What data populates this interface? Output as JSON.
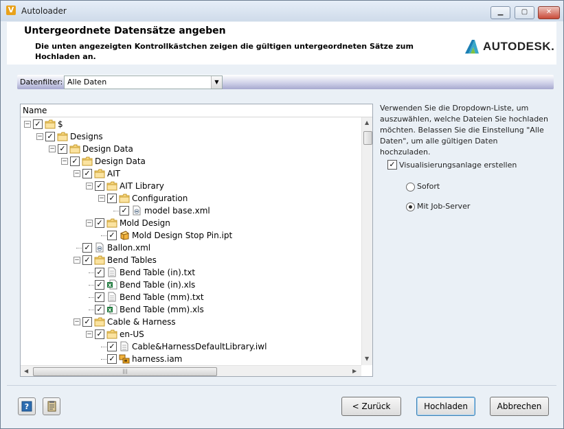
{
  "window": {
    "title": "Autoloader",
    "minimize": "▭",
    "maximize": "◻",
    "close": "✕"
  },
  "header": {
    "title": "Untergeordnete Datensätze angeben",
    "description": "Die unten angezeigten Kontrollkästchen zeigen die gültigen untergeordneten Sätze zum Hochladen an.",
    "logo_text": "AUTODESK."
  },
  "filter": {
    "label": "Datenfilter:",
    "value": "Alle Daten"
  },
  "tree": {
    "column_header": "Name",
    "rows": [
      {
        "label": "$",
        "level": 0,
        "type": "folder",
        "expander": true
      },
      {
        "label": "Designs",
        "level": 1,
        "type": "folder",
        "expander": true
      },
      {
        "label": "Design Data",
        "level": 2,
        "type": "folder",
        "expander": true
      },
      {
        "label": "Design Data",
        "level": 3,
        "type": "folder",
        "expander": true
      },
      {
        "label": "AIT",
        "level": 4,
        "type": "folder",
        "expander": true
      },
      {
        "label": "AIT Library",
        "level": 5,
        "type": "folder",
        "expander": true
      },
      {
        "label": "Configuration",
        "level": 6,
        "type": "folder",
        "expander": true
      },
      {
        "label": "model base.xml",
        "level": 7,
        "type": "xml",
        "expander": false
      },
      {
        "label": "Mold Design",
        "level": 5,
        "type": "folder",
        "expander": true
      },
      {
        "label": "Mold Design Stop Pin.ipt",
        "level": 6,
        "type": "ipt",
        "expander": false
      },
      {
        "label": "Ballon.xml",
        "level": 4,
        "type": "xml",
        "expander": false
      },
      {
        "label": "Bend Tables",
        "level": 4,
        "type": "folder",
        "expander": true
      },
      {
        "label": "Bend Table (in).txt",
        "level": 5,
        "type": "txt",
        "expander": false
      },
      {
        "label": "Bend Table (in).xls",
        "level": 5,
        "type": "xls",
        "expander": false
      },
      {
        "label": "Bend Table (mm).txt",
        "level": 5,
        "type": "txt",
        "expander": false
      },
      {
        "label": "Bend Table (mm).xls",
        "level": 5,
        "type": "xls",
        "expander": false
      },
      {
        "label": "Cable & Harness",
        "level": 4,
        "type": "folder",
        "expander": true
      },
      {
        "label": "en-US",
        "level": 5,
        "type": "folder",
        "expander": true
      },
      {
        "label": "Cable&HarnessDefaultLibrary.iwl",
        "level": 6,
        "type": "txt",
        "expander": false
      },
      {
        "label": "harness.iam",
        "level": 6,
        "type": "iam",
        "expander": false
      }
    ]
  },
  "info": {
    "text": "Verwenden Sie die Dropdown-Liste, um auszuwählen, welche Dateien Sie hochladen möchten. Belassen Sie die Einstellung \"Alle Daten\", um alle gültigen Daten hochzuladen.",
    "viz_checkbox_label": "Visualisierungsanlage erstellen",
    "viz_checked": true,
    "radio_now": "Sofort",
    "radio_job": "Mit Job-Server",
    "selected_radio": "job"
  },
  "footer": {
    "back": "< Zurück",
    "upload": "Hochladen",
    "cancel": "Abbrechen",
    "help_icon": "?",
    "clipboard_icon": "clipboard"
  }
}
